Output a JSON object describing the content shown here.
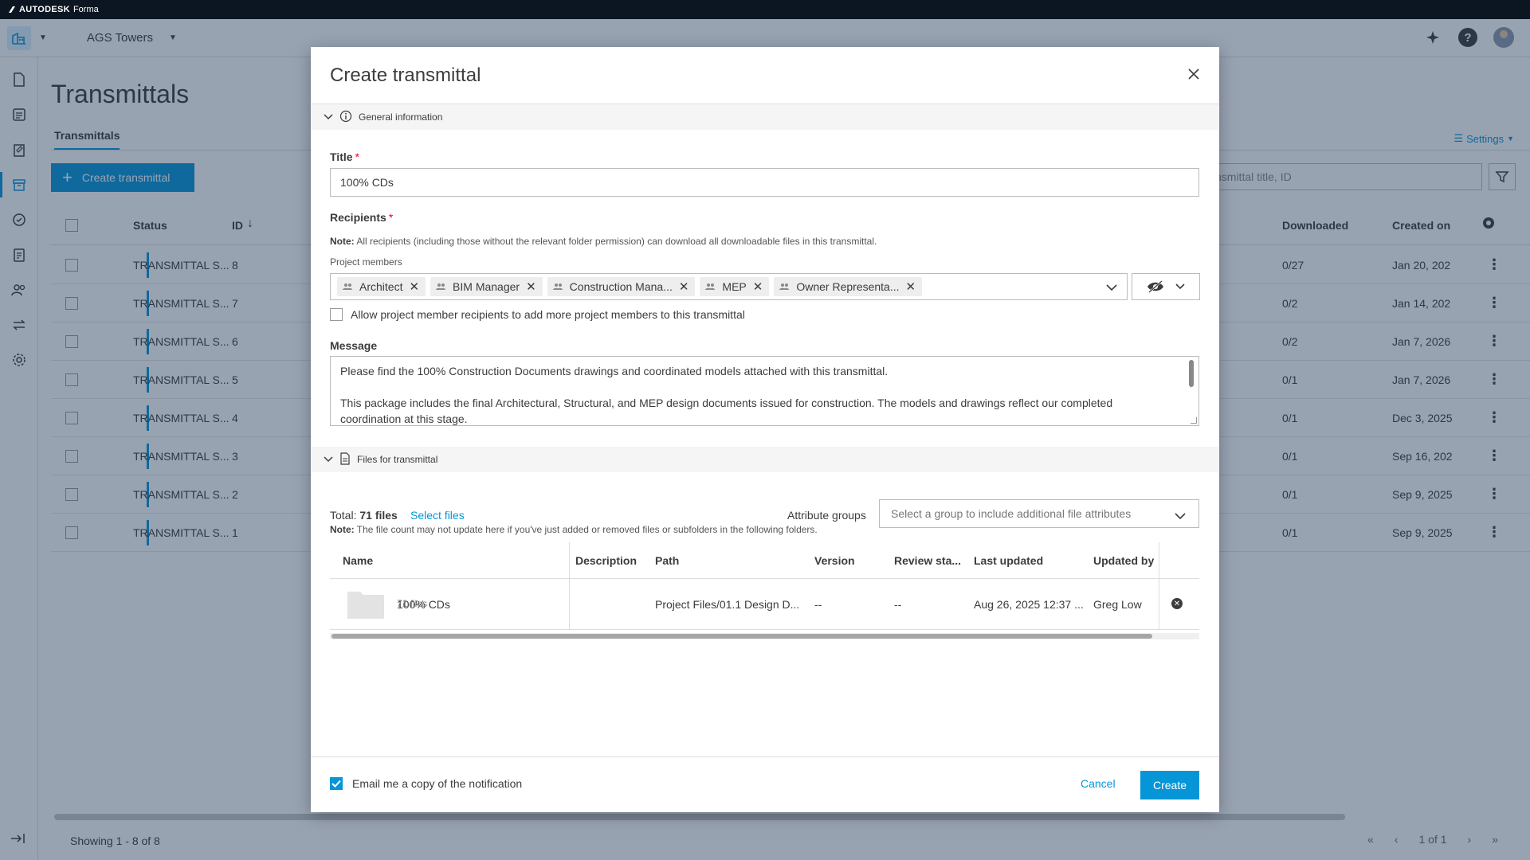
{
  "brand": {
    "company": "AUTODESK",
    "product": "Forma"
  },
  "topbar": {
    "project_name": "AGS Towers"
  },
  "page": {
    "title": "Transmittals",
    "tab": "Transmittals",
    "settings_label": "Settings",
    "create_button": "Create transmittal",
    "search_placeholder": "nsmittal title, ID",
    "columns": {
      "status": "Status",
      "id": "ID",
      "downloaded": "Downloaded",
      "created_on": "Created on"
    },
    "rows": [
      {
        "status": "TRANSMITTAL S...",
        "id": "8",
        "downloaded": "0/27",
        "created": "Jan 20, 202"
      },
      {
        "status": "TRANSMITTAL S...",
        "id": "7",
        "downloaded": "0/2",
        "created": "Jan 14, 202"
      },
      {
        "status": "TRANSMITTAL S...",
        "id": "6",
        "downloaded": "0/2",
        "created": "Jan 7, 2026"
      },
      {
        "status": "TRANSMITTAL S...",
        "id": "5",
        "downloaded": "0/1",
        "created": "Jan 7, 2026"
      },
      {
        "status": "TRANSMITTAL S...",
        "id": "4",
        "downloaded": "0/1",
        "created": "Dec 3, 2025"
      },
      {
        "status": "TRANSMITTAL S...",
        "id": "3",
        "downloaded": "0/1",
        "created": "Sep 16, 202"
      },
      {
        "status": "TRANSMITTAL S...",
        "id": "2",
        "downloaded": "0/1",
        "created": "Sep 9, 2025"
      },
      {
        "status": "TRANSMITTAL S...",
        "id": "1",
        "downloaded": "0/1",
        "created": "Sep 9, 2025"
      }
    ],
    "footer": {
      "showing": "Showing 1 - 8 of 8",
      "page_of": "1 of 1"
    }
  },
  "modal": {
    "title": "Create transmittal",
    "general_section": "General information",
    "title_label": "Title",
    "title_value": "100% CDs",
    "recipients_label": "Recipients",
    "recipients_note_bold": "Note:",
    "recipients_note": "All recipients (including those without the relevant folder permission) can download all downloadable files in this transmittal.",
    "project_members_label": "Project members",
    "chips": [
      "Architect",
      "BIM Manager",
      "Construction Mana...",
      "MEP",
      "Owner Representa..."
    ],
    "allow_label": "Allow project member recipients to add more project members to this transmittal",
    "message_label": "Message",
    "message_p1": "Please find the 100% Construction Documents drawings and coordinated models attached with this transmittal.",
    "message_p2": "This package includes the final Architectural, Structural, and MEP design documents issued for construction. The models and drawings reflect our completed coordination at this stage.",
    "files_section": "Files for transmittal",
    "total_prefix": "Total:",
    "total_value": "71 files",
    "select_files": "Select files",
    "attribute_groups_label": "Attribute groups",
    "attribute_groups_placeholder": "Select a group to include additional file attributes",
    "files_note_bold": "Note:",
    "files_note": "The file count may not update here if you've just added or removed files or subfolders in the following folders.",
    "file_columns": {
      "name": "Name",
      "description": "Description",
      "path": "Path",
      "version": "Version",
      "review": "Review sta...",
      "last_updated": "Last updated",
      "updated_by": "Updated by"
    },
    "file_row": {
      "name": "100% CDs",
      "count": "71 files",
      "path": "Project Files/01.1 Design D...",
      "version": "--",
      "review": "--",
      "last_updated": "Aug 26, 2025 12:37 ...",
      "updated_by": "Greg Low"
    },
    "email_copy_label": "Email me a copy of the notification",
    "cancel": "Cancel",
    "create": "Create"
  },
  "colors": {
    "accent": "#0696d7",
    "required": "#e4002b",
    "overlay": "#1a3254"
  }
}
